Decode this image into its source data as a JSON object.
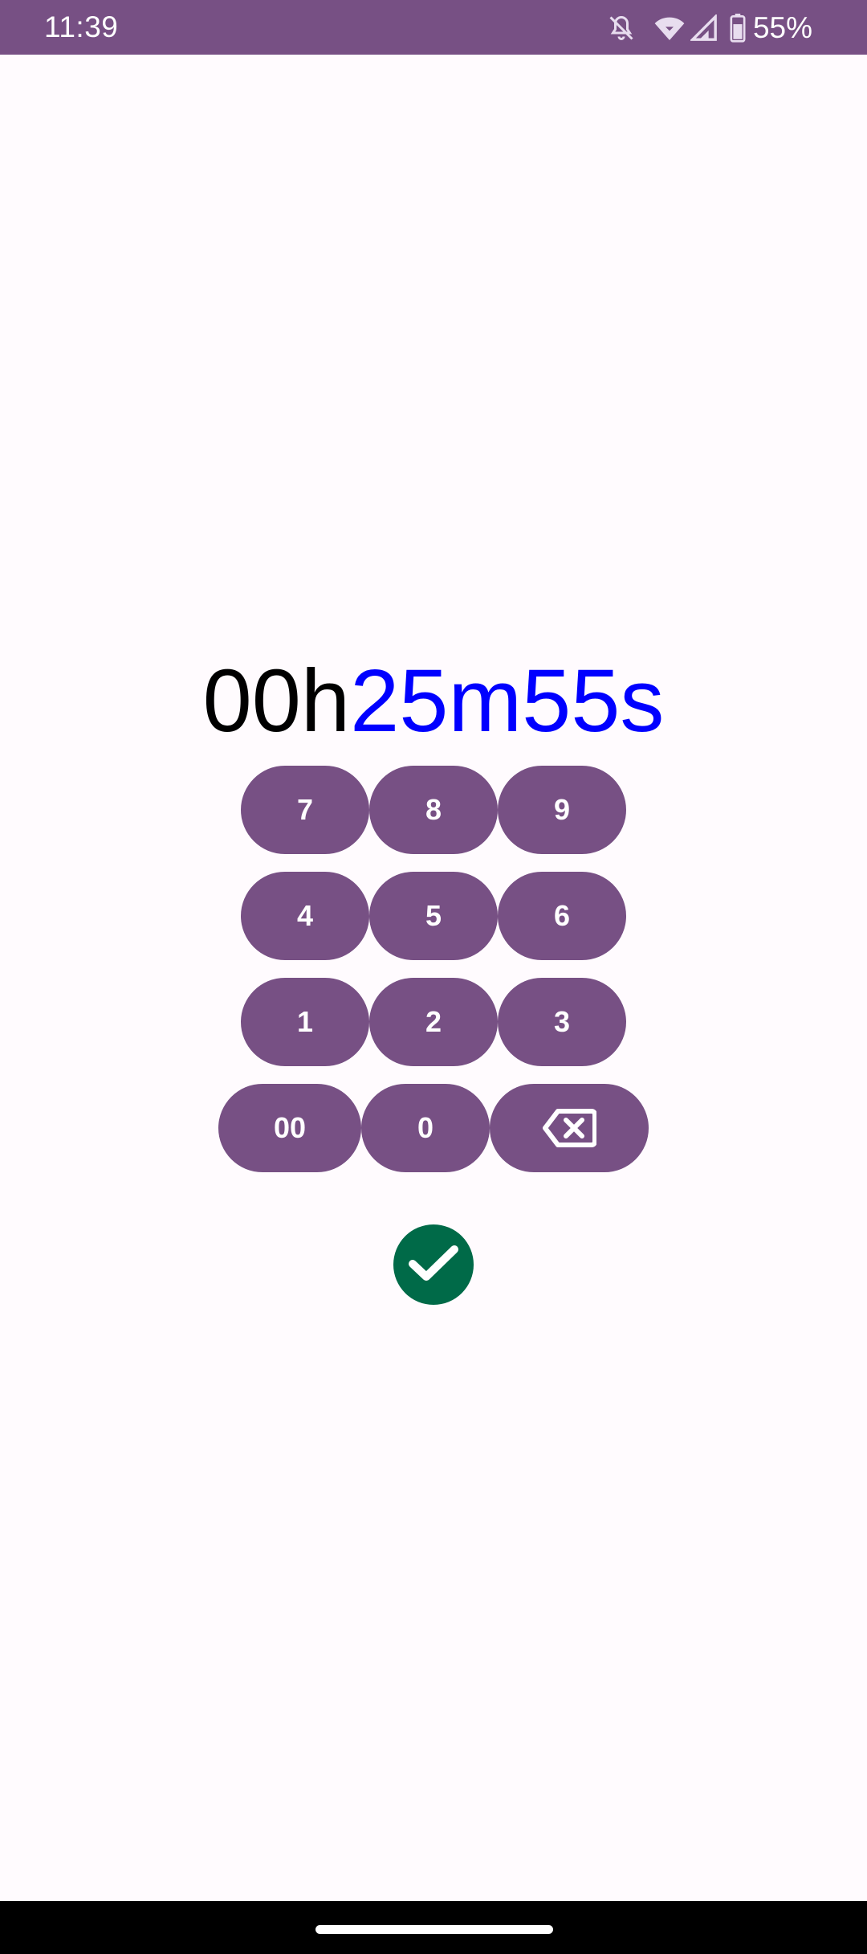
{
  "status_bar": {
    "time": "11:39",
    "battery_percent": "55%",
    "icons": [
      "bell-off-icon",
      "wifi-icon",
      "signal-icon",
      "battery-icon"
    ],
    "background": "#775084"
  },
  "timer": {
    "hours": "00h",
    "minutes": "25m",
    "seconds": "55s",
    "unset_color": "#000000",
    "set_color": "#0000ff"
  },
  "keypad": {
    "keys": {
      "k7": "7",
      "k8": "8",
      "k9": "9",
      "k4": "4",
      "k5": "5",
      "k6": "6",
      "k1": "1",
      "k2": "2",
      "k3": "3",
      "k00": "00",
      "k0": "0"
    },
    "backspace_icon": "backspace-icon",
    "key_color": "#775084"
  },
  "confirm": {
    "icon": "check-icon",
    "color": "#006a48"
  }
}
